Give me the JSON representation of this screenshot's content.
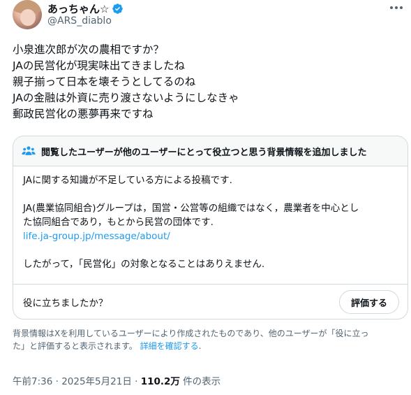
{
  "author": {
    "display_name": "あっちゃん☆",
    "handle": "@ARS_diablo"
  },
  "tweet": {
    "lines": [
      "小泉進次郎が次の農相ですか？",
      "JAの民営化が現実味出てきましたね",
      "親子揃って日本を壊そうとしてるのね",
      "JAの金融は外資に売り渡さないようにしなきゃ",
      "郵政民営化の悪夢再来ですね"
    ]
  },
  "community_note": {
    "title": "閲覧したユーザーが他のユーザーにとって役立つと思う背景情報を追加しました",
    "paragraph1": "JAに関する知識が不足している方による投稿です.",
    "paragraph2_line1": "JA(農業協同組合)グループは，国営・公営等の組織ではなく，農業者を中心とし",
    "paragraph2_line2": "た協同組合であり，もとから民営の団体です.",
    "link": "life.ja-group.jp/message/about/",
    "paragraph3": "したがって，「民営化」の対象となることはありえません.",
    "helpful_question": "役に立ちましたか？",
    "rate_button": "評価する"
  },
  "disclaimer": {
    "line1": "背景情報はXを利用しているユーザーにより作成されたものであり、他のユーザーが「役に立っ",
    "line2_prefix": "た」と評価すると表示されます。 ",
    "detail_link": "詳細を確認する",
    "line2_suffix": "."
  },
  "meta": {
    "timestamp": "午前7:36 · 2025年5月21日 · ",
    "views": "110.2万",
    "views_suffix": " 件の表示"
  },
  "colors": {
    "link": "#1d9bf0",
    "secondary_text": "#536471",
    "border": "#cfd9de"
  },
  "icons": {
    "verified": "verified-badge-icon",
    "more": "more-options-icon",
    "note": "people-icon"
  }
}
